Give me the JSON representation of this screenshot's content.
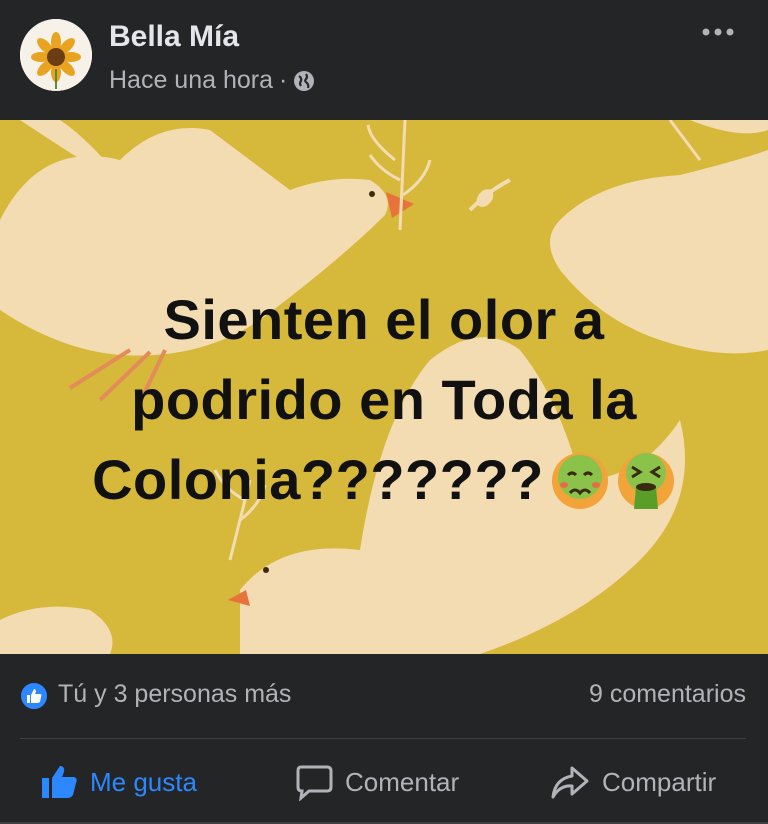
{
  "post": {
    "author": "Bella Mía",
    "time": "Hace una hora",
    "separator": "·",
    "privacy_icon": "globe-icon",
    "menu_icon": "more-options-icon",
    "text_lines": [
      "Sienten el olor a",
      "podrido en Toda la",
      "Colonia???????"
    ],
    "emojis": [
      "nauseated-face-emoji",
      "vomiting-face-emoji"
    ],
    "background_color": "#d6b83a"
  },
  "reactions": {
    "summary": "Tú y 3 personas más",
    "comments": "9 comentarios",
    "badge_color": "#2d88ff"
  },
  "actions": {
    "like_label": "Me gusta",
    "comment_label": "Comentar",
    "share_label": "Compartir"
  }
}
